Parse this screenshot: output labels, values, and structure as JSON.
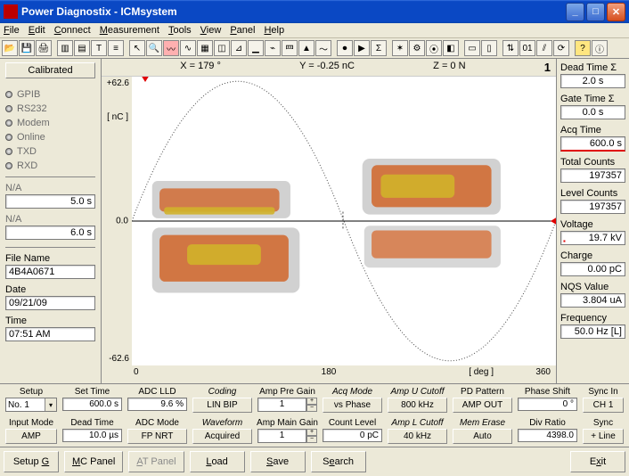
{
  "window": {
    "title": "Power Diagnostix - ICMsystem",
    "min_btn": "_",
    "max_btn": "□",
    "close_btn": "✕"
  },
  "menu": {
    "file": "File",
    "edit": "Edit",
    "connect": "Connect",
    "measurement": "Measurement",
    "tools": "Tools",
    "view": "View",
    "panel": "Panel",
    "help": "Help"
  },
  "plot_header": {
    "x_label": "X = 179 °",
    "y_label": "Y = -0.25 nC",
    "z_label": "Z =    0 N",
    "corner": "1"
  },
  "yaxis": {
    "top": "+62.6",
    "mid": "0.0",
    "bot": "-62.6",
    "unit": "[ nC ]"
  },
  "xaxis": {
    "t0": "0",
    "t180": "180",
    "t360": "360",
    "unit": "[ deg ]"
  },
  "left": {
    "calibrated": "Calibrated",
    "status": [
      "GPIB",
      "RS232",
      "Modem",
      "Online",
      "TXD",
      "RXD"
    ],
    "na1_label": "N/A",
    "na1_value": "5.0 s",
    "na2_label": "N/A",
    "na2_value": "6.0 s",
    "filename_label": "File Name",
    "filename_value": "4B4A0671",
    "date_label": "Date",
    "date_value": "09/21/09",
    "time_label": "Time",
    "time_value": "07:51 AM"
  },
  "right": {
    "dead_time_sigma_label": "Dead Time  Σ",
    "dead_time_sigma_value": "2.0 s",
    "gate_time_sigma_label": "Gate Time  Σ",
    "gate_time_sigma_value": "0.0 s",
    "acq_time_label": "Acq Time",
    "acq_time_value": "600.0 s",
    "total_counts_label": "Total Counts",
    "total_counts_value": "197357",
    "level_counts_label": "Level Counts",
    "level_counts_value": "197357",
    "voltage_label": "Voltage",
    "voltage_value": "19.7 kV",
    "charge_label": "Charge",
    "charge_value": "0.00 pC",
    "nqs_label": "NQS Value",
    "nqs_value": "3.804 uA",
    "freq_label": "Frequency",
    "freq_value": "50.0 Hz [L]"
  },
  "ctrl_row1": {
    "setup_label": "Setup",
    "setup_value": "No. 1",
    "set_time_label": "Set Time",
    "set_time_value": "600.0 s",
    "adc_lld_label": "ADC LLD",
    "adc_lld_value": "9.6 %",
    "coding_label": "Coding",
    "coding_value": "LIN BIP",
    "amp_pre_label": "Amp Pre Gain",
    "amp_pre_value": "1",
    "acq_mode_label": "Acq Mode",
    "acq_mode_value": "vs Phase",
    "amp_u_label": "Amp U Cutoff",
    "amp_u_value": "800 kHz",
    "pd_pattern_label": "PD Pattern",
    "pd_pattern_value": "AMP OUT",
    "phase_shift_label": "Phase Shift",
    "phase_shift_value": "0 °",
    "sync_in_label": "Sync In",
    "sync_in_value": "CH 1"
  },
  "ctrl_row2": {
    "input_mode_label": "Input Mode",
    "input_mode_value": "AMP",
    "dead_time_label": "Dead Time",
    "dead_time_value": "10.0 µs",
    "adc_mode_label": "ADC Mode",
    "adc_mode_value": "FP NRT",
    "waveform_label": "Waveform",
    "waveform_value": "Acquired",
    "amp_main_label": "Amp Main Gain",
    "amp_main_value": "1",
    "count_level_label": "Count Level",
    "count_level_value": "0 pC",
    "amp_l_label": "Amp L Cutoff",
    "amp_l_value": "40 kHz",
    "mem_erase_label": "Mem Erase",
    "mem_erase_value": "Auto",
    "div_ratio_label": "Div Ratio",
    "div_ratio_value": "4398.0",
    "sync_label": "Sync",
    "sync_value": "+ Line"
  },
  "bottom": {
    "setup_g": "Setup G",
    "mc_panel": "MC Panel",
    "at_panel": "AT Panel",
    "load": "Load",
    "save": "Save",
    "search": "Search",
    "exit": "Exit"
  },
  "chart_data": {
    "type": "scatter",
    "title": "",
    "xlabel": "deg",
    "ylabel": "nC",
    "xlim": [
      0,
      360
    ],
    "ylim": [
      -62.6,
      62.6
    ],
    "cursor": {
      "x": 179,
      "y": -0.25,
      "z": 0
    },
    "overlay_sine": {
      "amplitude": 55,
      "period_deg": 360,
      "phase_deg": 0
    },
    "series": [
      {
        "name": "pd-cluster-pos-left",
        "description": "Dense PD cluster, positive half, left lobe",
        "x_range_deg": [
          20,
          150
        ],
        "y_range_nC": [
          2,
          20
        ],
        "density": "high",
        "color_gradient": [
          "#6a6a6a",
          "#ff4b00",
          "#ffd000"
        ]
      },
      {
        "name": "pd-cluster-pos-right",
        "description": "Dense PD cluster, positive half, right lobe",
        "x_range_deg": [
          210,
          330
        ],
        "y_range_nC": [
          3,
          26
        ],
        "density": "high",
        "color_gradient": [
          "#6a6a6a",
          "#ff4b00",
          "#ffd000"
        ]
      },
      {
        "name": "pd-cluster-neg-left",
        "description": "Dense PD cluster, negative half, left lobe",
        "x_range_deg": [
          20,
          150
        ],
        "y_range_nC": [
          -28,
          -3
        ],
        "density": "high",
        "color_gradient": [
          "#6a6a6a",
          "#ff4b00",
          "#ffd000"
        ]
      },
      {
        "name": "pd-cluster-neg-right",
        "description": "Sparse PD cluster, negative half, right lobe",
        "x_range_deg": [
          210,
          330
        ],
        "y_range_nC": [
          -18,
          -2
        ],
        "density": "medium",
        "color_gradient": [
          "#6a6a6a",
          "#ff4b00"
        ]
      }
    ]
  }
}
